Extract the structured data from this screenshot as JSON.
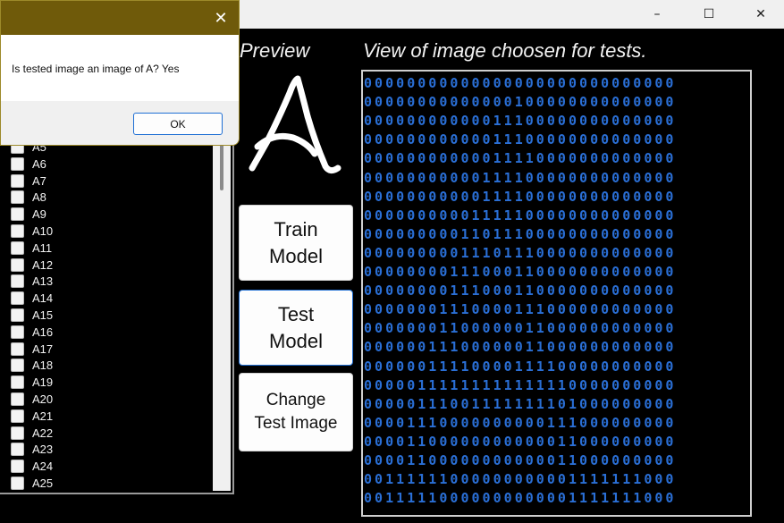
{
  "window": {
    "controls": {
      "minimize": "–",
      "maximize": "☐",
      "close": "✕"
    }
  },
  "headings": {
    "preview": "Preview",
    "view": "View of image choosen for tests."
  },
  "preview": {
    "letter_icon": "handwritten-A-icon"
  },
  "list": {
    "items": [
      "A5",
      "A6",
      "A7",
      "A8",
      "A9",
      "A10",
      "A11",
      "A12",
      "A13",
      "A14",
      "A15",
      "A16",
      "A17",
      "A18",
      "A19",
      "A20",
      "A21",
      "A22",
      "A23",
      "A24",
      "A25"
    ]
  },
  "buttons": {
    "train": "Train\nModel",
    "test": "Test\nModel",
    "change": "Change\nTest Image"
  },
  "matrix": {
    "rows": [
      "00000000000000000000000000000",
      "00000000000000100000000000000",
      "00000000000011100000000000000",
      "00000000000011100000000000000",
      "00000000000011110000000000000",
      "00000000000111100000000000000",
      "00000000000111100000000000000",
      "00000000001111100000000000000",
      "00000000011011100000000000000",
      "00000000011101110000000000000",
      "00000000111000110000000000000",
      "00000000111000110000000000000",
      "00000001110000111000000000000",
      "00000001100000011000000000000",
      "00000011100000011000000000000",
      "00000011110000111100000000000",
      "00000111111111111110000000000",
      "00000111001111111101000000000",
      "00001110000000000111000000000",
      "00001100000000000011000000000",
      "00001100000000000011000000000",
      "00111111000000000001111111000",
      "00111110000000000001111111000"
    ]
  },
  "dialog": {
    "message": "Is tested image an image of A? Yes",
    "ok": "OK",
    "close": "✕"
  },
  "colors": {
    "matrix_text": "#2a6fd6",
    "dialog_title": "#6f5a0a",
    "background": "#000000"
  }
}
